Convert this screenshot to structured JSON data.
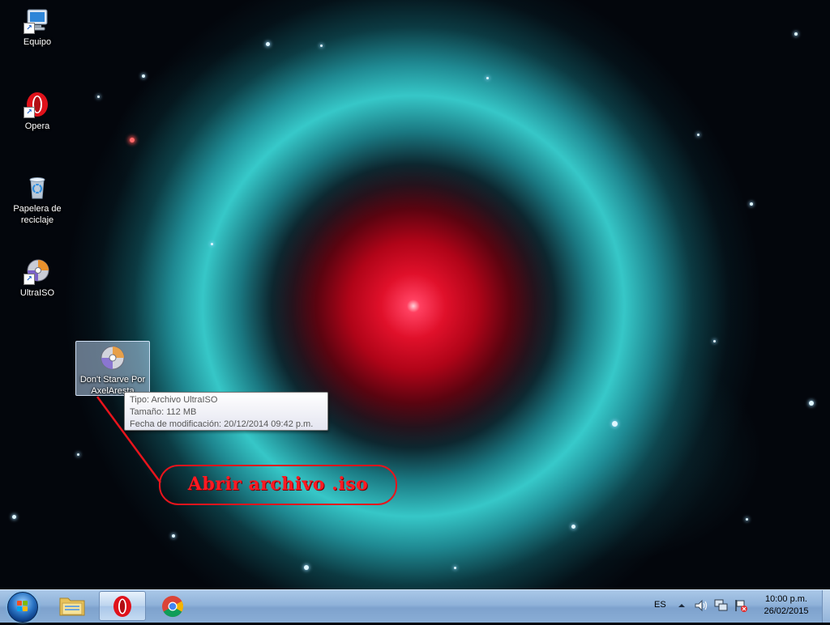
{
  "desktop": {
    "icons": [
      {
        "label": "Equipo"
      },
      {
        "label": "Opera"
      },
      {
        "label": "Papelera de reciclaje"
      },
      {
        "label": "UltraISO"
      },
      {
        "label": "Don't Starve Por AxelAresta"
      }
    ]
  },
  "tooltip": {
    "line1": "Tipo: Archivo UltraISO",
    "line2": "Tamaño: 112 MB",
    "line3": "Fecha de modificación: 20/12/2014 09:42 p.m."
  },
  "annotation": {
    "text": "Abrir archivo .iso",
    "color": "#ff1a22"
  },
  "taskbar": {
    "pinned": [
      "windows-explorer-icon",
      "opera-icon",
      "chrome-icon"
    ],
    "active": "opera-icon"
  },
  "tray": {
    "language": "ES",
    "time": "10:00 p.m.",
    "date": "26/02/2015"
  },
  "colors": {
    "taskbar": "#8fb2d9",
    "selection": "#b4cdeb",
    "annotation_red": "#e8141c"
  }
}
